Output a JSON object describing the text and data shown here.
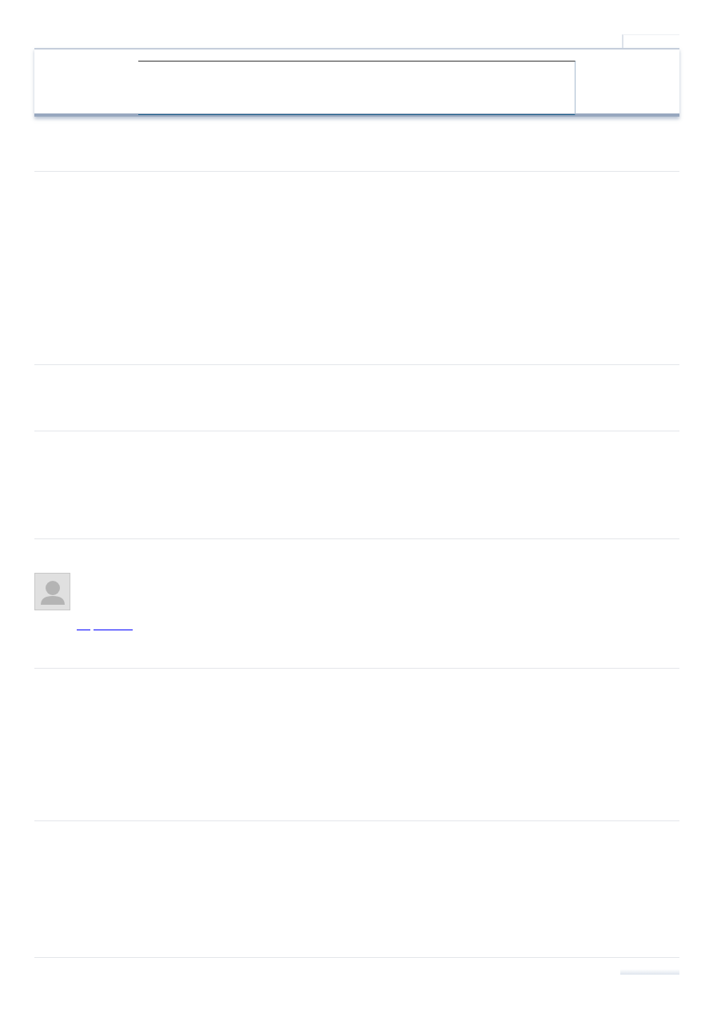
{
  "header": {
    "kind": "search"
  },
  "profile": {
    "kind": "avatar",
    "links": [
      {
        "kind": "short"
      },
      {
        "kind": "long"
      }
    ]
  }
}
